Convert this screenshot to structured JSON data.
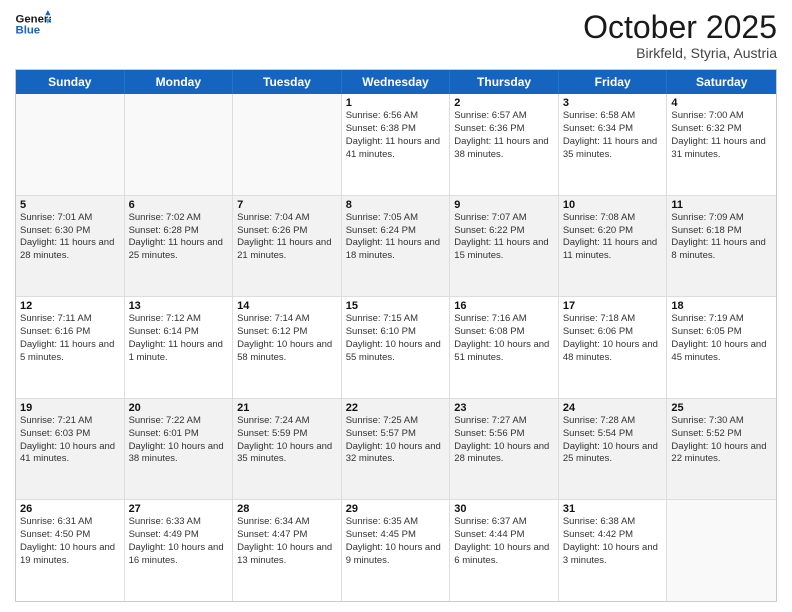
{
  "header": {
    "logo_line1": "General",
    "logo_line2": "Blue",
    "month": "October 2025",
    "location": "Birkfeld, Styria, Austria"
  },
  "days_of_week": [
    "Sunday",
    "Monday",
    "Tuesday",
    "Wednesday",
    "Thursday",
    "Friday",
    "Saturday"
  ],
  "rows": [
    [
      {
        "day": "",
        "sunrise": "",
        "sunset": "",
        "daylight": "",
        "empty": true
      },
      {
        "day": "",
        "sunrise": "",
        "sunset": "",
        "daylight": "",
        "empty": true
      },
      {
        "day": "",
        "sunrise": "",
        "sunset": "",
        "daylight": "",
        "empty": true
      },
      {
        "day": "1",
        "sunrise": "Sunrise: 6:56 AM",
        "sunset": "Sunset: 6:38 PM",
        "daylight": "Daylight: 11 hours and 41 minutes."
      },
      {
        "day": "2",
        "sunrise": "Sunrise: 6:57 AM",
        "sunset": "Sunset: 6:36 PM",
        "daylight": "Daylight: 11 hours and 38 minutes."
      },
      {
        "day": "3",
        "sunrise": "Sunrise: 6:58 AM",
        "sunset": "Sunset: 6:34 PM",
        "daylight": "Daylight: 11 hours and 35 minutes."
      },
      {
        "day": "4",
        "sunrise": "Sunrise: 7:00 AM",
        "sunset": "Sunset: 6:32 PM",
        "daylight": "Daylight: 11 hours and 31 minutes."
      }
    ],
    [
      {
        "day": "5",
        "sunrise": "Sunrise: 7:01 AM",
        "sunset": "Sunset: 6:30 PM",
        "daylight": "Daylight: 11 hours and 28 minutes."
      },
      {
        "day": "6",
        "sunrise": "Sunrise: 7:02 AM",
        "sunset": "Sunset: 6:28 PM",
        "daylight": "Daylight: 11 hours and 25 minutes."
      },
      {
        "day": "7",
        "sunrise": "Sunrise: 7:04 AM",
        "sunset": "Sunset: 6:26 PM",
        "daylight": "Daylight: 11 hours and 21 minutes."
      },
      {
        "day": "8",
        "sunrise": "Sunrise: 7:05 AM",
        "sunset": "Sunset: 6:24 PM",
        "daylight": "Daylight: 11 hours and 18 minutes."
      },
      {
        "day": "9",
        "sunrise": "Sunrise: 7:07 AM",
        "sunset": "Sunset: 6:22 PM",
        "daylight": "Daylight: 11 hours and 15 minutes."
      },
      {
        "day": "10",
        "sunrise": "Sunrise: 7:08 AM",
        "sunset": "Sunset: 6:20 PM",
        "daylight": "Daylight: 11 hours and 11 minutes."
      },
      {
        "day": "11",
        "sunrise": "Sunrise: 7:09 AM",
        "sunset": "Sunset: 6:18 PM",
        "daylight": "Daylight: 11 hours and 8 minutes."
      }
    ],
    [
      {
        "day": "12",
        "sunrise": "Sunrise: 7:11 AM",
        "sunset": "Sunset: 6:16 PM",
        "daylight": "Daylight: 11 hours and 5 minutes."
      },
      {
        "day": "13",
        "sunrise": "Sunrise: 7:12 AM",
        "sunset": "Sunset: 6:14 PM",
        "daylight": "Daylight: 11 hours and 1 minute."
      },
      {
        "day": "14",
        "sunrise": "Sunrise: 7:14 AM",
        "sunset": "Sunset: 6:12 PM",
        "daylight": "Daylight: 10 hours and 58 minutes."
      },
      {
        "day": "15",
        "sunrise": "Sunrise: 7:15 AM",
        "sunset": "Sunset: 6:10 PM",
        "daylight": "Daylight: 10 hours and 55 minutes."
      },
      {
        "day": "16",
        "sunrise": "Sunrise: 7:16 AM",
        "sunset": "Sunset: 6:08 PM",
        "daylight": "Daylight: 10 hours and 51 minutes."
      },
      {
        "day": "17",
        "sunrise": "Sunrise: 7:18 AM",
        "sunset": "Sunset: 6:06 PM",
        "daylight": "Daylight: 10 hours and 48 minutes."
      },
      {
        "day": "18",
        "sunrise": "Sunrise: 7:19 AM",
        "sunset": "Sunset: 6:05 PM",
        "daylight": "Daylight: 10 hours and 45 minutes."
      }
    ],
    [
      {
        "day": "19",
        "sunrise": "Sunrise: 7:21 AM",
        "sunset": "Sunset: 6:03 PM",
        "daylight": "Daylight: 10 hours and 41 minutes."
      },
      {
        "day": "20",
        "sunrise": "Sunrise: 7:22 AM",
        "sunset": "Sunset: 6:01 PM",
        "daylight": "Daylight: 10 hours and 38 minutes."
      },
      {
        "day": "21",
        "sunrise": "Sunrise: 7:24 AM",
        "sunset": "Sunset: 5:59 PM",
        "daylight": "Daylight: 10 hours and 35 minutes."
      },
      {
        "day": "22",
        "sunrise": "Sunrise: 7:25 AM",
        "sunset": "Sunset: 5:57 PM",
        "daylight": "Daylight: 10 hours and 32 minutes."
      },
      {
        "day": "23",
        "sunrise": "Sunrise: 7:27 AM",
        "sunset": "Sunset: 5:56 PM",
        "daylight": "Daylight: 10 hours and 28 minutes."
      },
      {
        "day": "24",
        "sunrise": "Sunrise: 7:28 AM",
        "sunset": "Sunset: 5:54 PM",
        "daylight": "Daylight: 10 hours and 25 minutes."
      },
      {
        "day": "25",
        "sunrise": "Sunrise: 7:30 AM",
        "sunset": "Sunset: 5:52 PM",
        "daylight": "Daylight: 10 hours and 22 minutes."
      }
    ],
    [
      {
        "day": "26",
        "sunrise": "Sunrise: 6:31 AM",
        "sunset": "Sunset: 4:50 PM",
        "daylight": "Daylight: 10 hours and 19 minutes."
      },
      {
        "day": "27",
        "sunrise": "Sunrise: 6:33 AM",
        "sunset": "Sunset: 4:49 PM",
        "daylight": "Daylight: 10 hours and 16 minutes."
      },
      {
        "day": "28",
        "sunrise": "Sunrise: 6:34 AM",
        "sunset": "Sunset: 4:47 PM",
        "daylight": "Daylight: 10 hours and 13 minutes."
      },
      {
        "day": "29",
        "sunrise": "Sunrise: 6:35 AM",
        "sunset": "Sunset: 4:45 PM",
        "daylight": "Daylight: 10 hours and 9 minutes."
      },
      {
        "day": "30",
        "sunrise": "Sunrise: 6:37 AM",
        "sunset": "Sunset: 4:44 PM",
        "daylight": "Daylight: 10 hours and 6 minutes."
      },
      {
        "day": "31",
        "sunrise": "Sunrise: 6:38 AM",
        "sunset": "Sunset: 4:42 PM",
        "daylight": "Daylight: 10 hours and 3 minutes."
      },
      {
        "day": "",
        "sunrise": "",
        "sunset": "",
        "daylight": "",
        "empty": true
      }
    ]
  ]
}
